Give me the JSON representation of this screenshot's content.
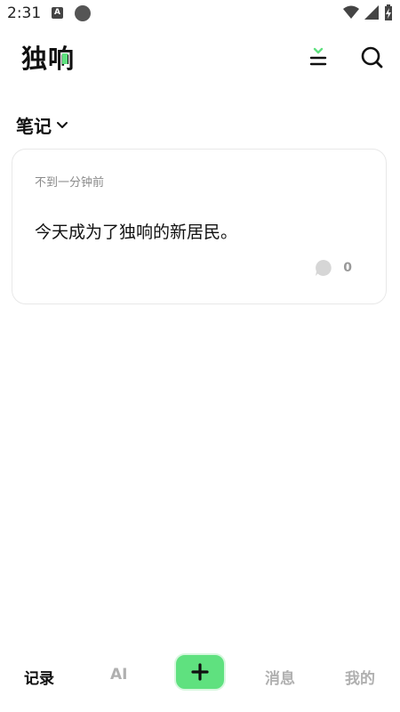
{
  "status_bar": {
    "time": "2:31",
    "notification_letter": "A"
  },
  "header": {
    "logo_text": "独响",
    "logo_accent_color": "#5fe17f"
  },
  "section": {
    "label": "笔记"
  },
  "note": {
    "time_ago": "不到一分钟前",
    "text": "今天成为了独响的新居民。",
    "comment_count": "0"
  },
  "bottom_nav": {
    "records": "记录",
    "ai": "AI",
    "messages": "消息",
    "mine": "我的"
  },
  "colors": {
    "accent": "#5fe17f"
  }
}
